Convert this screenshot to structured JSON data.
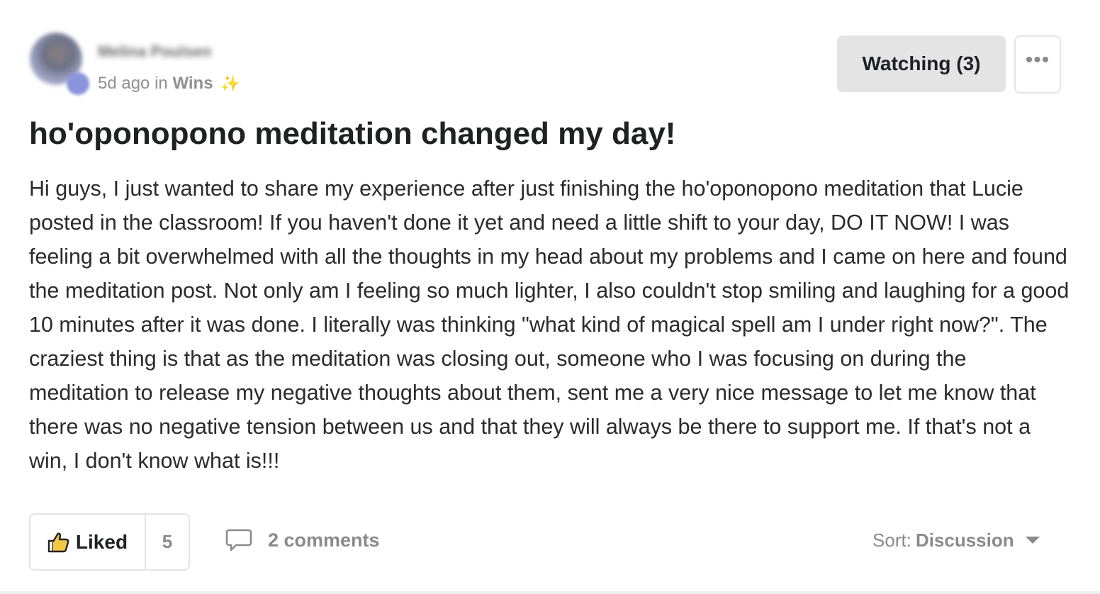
{
  "post": {
    "author": {
      "name": "Melina Poulsen"
    },
    "meta": {
      "time_prefix": "5d ago in",
      "category": "Wins",
      "sparkle_icon": "✨"
    },
    "watch_label": "Watching (3)",
    "more_label": "•••",
    "title": "ho'oponopono meditation changed my day!",
    "body": "Hi guys, I just wanted to share my experience after just finishing the ho'oponopono meditation that Lucie posted in the classroom! If you haven't done it yet and need a little shift to your day, DO IT NOW! I was feeling a bit overwhelmed with all the thoughts in my head about my problems and I came on here and found the meditation post. Not only am I feeling so much lighter, I also couldn't stop smiling and laughing for a good 10 minutes after it was done. I literally was thinking \"what kind of magical spell am I under right now?\". The craziest thing is that as the meditation was closing out, someone who I was focusing on during the meditation to release my negative thoughts about them, sent me a very nice message to let me know that there was no negative tension between us and that they will always be there to support me. If that's not a win, I don't know what is!!!"
  },
  "footer": {
    "like_label": "Liked",
    "like_count": "5",
    "comments_label": "2 comments",
    "sort_label": "Sort:",
    "sort_value": "Discussion"
  },
  "colors": {
    "accent": "#f2c744",
    "button_gray": "#e4e4e4",
    "muted_text": "#8a8a8a"
  },
  "icons": {
    "like": "thumbs-up-icon",
    "comments": "speech-bubble-icon",
    "sort": "caret-down-icon",
    "more": "ellipsis-icon"
  }
}
